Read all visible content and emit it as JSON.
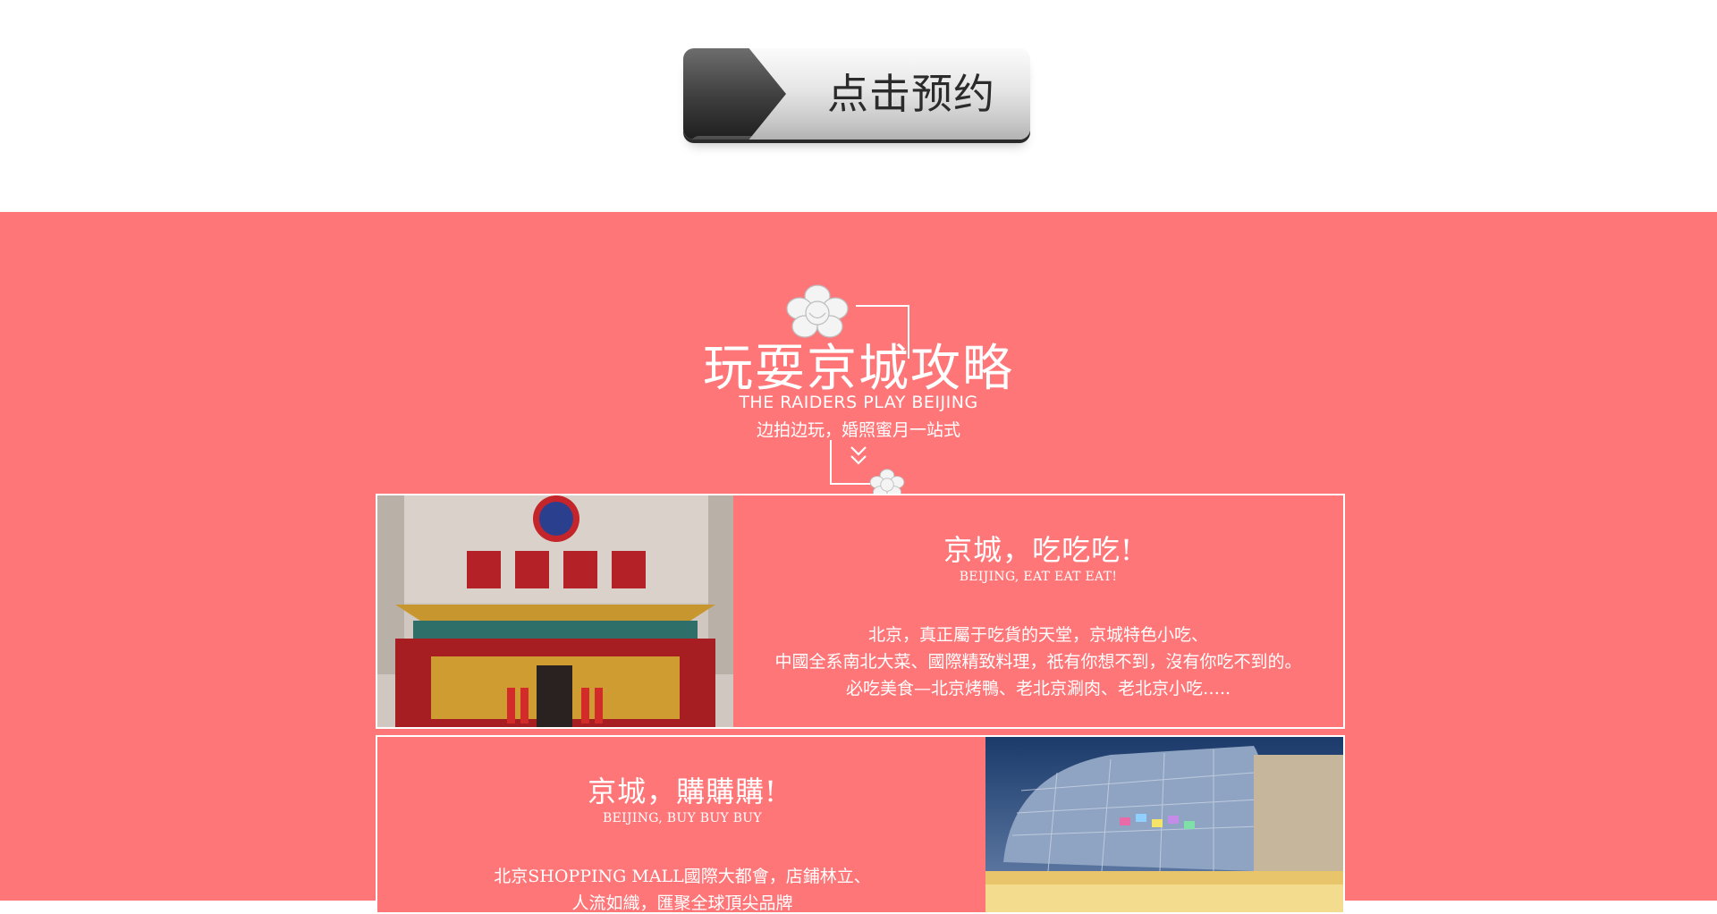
{
  "booking": {
    "label": "点击预约"
  },
  "section": {
    "title": "玩耍京城攻略",
    "subtitle_en": "THE RAIDERS PLAY BEIJING",
    "subtitle_cn": "边拍边玩，婚照蜜月一站式"
  },
  "cards": [
    {
      "title_cn": "京城，吃吃吃!",
      "title_en": "BEIJING, EAT EAT EAT!",
      "lines": [
        "北京，真正屬于吃貨的天堂，京城特色小吃、",
        "中國全系南北大菜、國際精致料理，祇有你想不到，沒有你吃不到的。",
        "必吃美食—北京烤鴨、老北京涮肉、老北京小吃….."
      ]
    },
    {
      "title_cn": "京城，購購購!",
      "title_en": "BEIJING, BUY BUY BUY",
      "lines": [
        "北京SHOPPING MALL國際大都會，店鋪林立、",
        "人流如織，匯聚全球頂尖品牌"
      ]
    }
  ],
  "colors": {
    "pink": "#fe7678",
    "white": "#ffffff"
  }
}
